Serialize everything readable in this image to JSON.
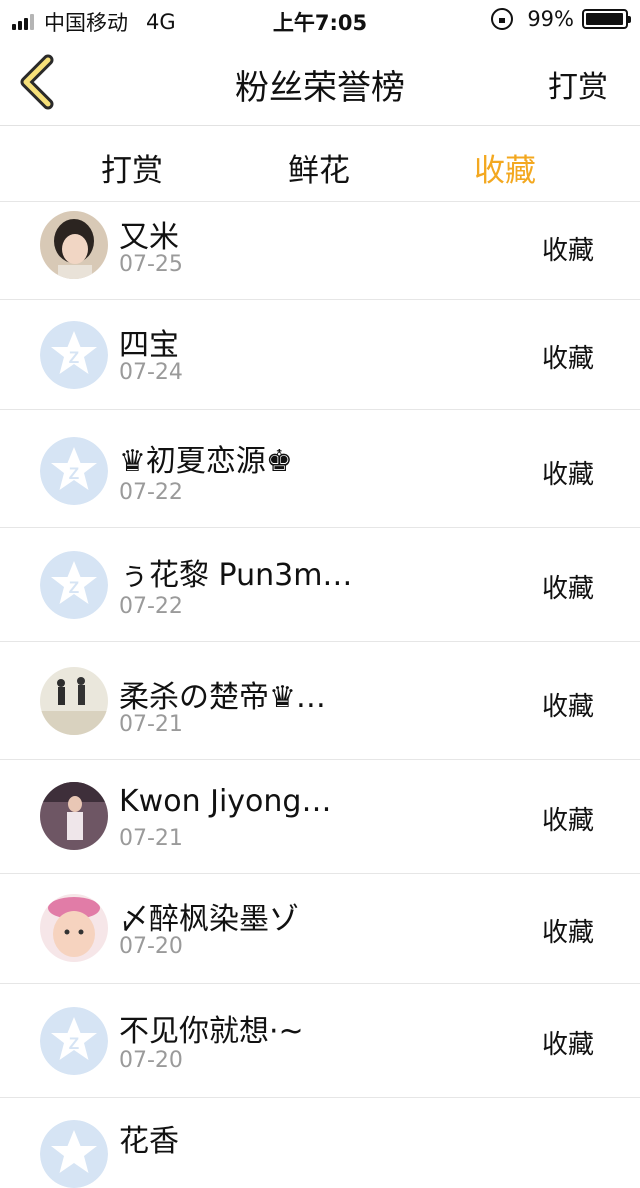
{
  "status_bar": {
    "carrier": "中国移动",
    "network": "4G",
    "time": "上午7:05",
    "battery": "99%"
  },
  "nav": {
    "title": "粉丝荣誉榜",
    "action": "打赏"
  },
  "tabs": [
    {
      "label": "打赏",
      "active": false
    },
    {
      "label": "鲜花",
      "active": false
    },
    {
      "label": "收藏",
      "active": true
    }
  ],
  "colors": {
    "accent": "#f3a820",
    "date_text": "#9a9a9a",
    "placeholder_avatar": "#d6e4f4"
  },
  "fans": [
    {
      "name": "又米",
      "date": "07-25",
      "action": "收藏",
      "avatar": "photo-girl"
    },
    {
      "name": "四宝",
      "date": "07-24",
      "action": "收藏",
      "avatar": "default-star"
    },
    {
      "name": "♛初夏恋源♚",
      "date": "07-22",
      "action": "收藏",
      "avatar": "default-star"
    },
    {
      "name": "ぅ花黎 Pun3m…",
      "date": "07-22",
      "action": "收藏",
      "avatar": "default-star"
    },
    {
      "name": "柔杀の楚帝♛…",
      "date": "07-21",
      "action": "收藏",
      "avatar": "photo-beach"
    },
    {
      "name": "Kwon Jiyong…",
      "date": "07-21",
      "action": "收藏",
      "avatar": "photo-woman"
    },
    {
      "name": "〆醉枫染墨ゾ",
      "date": "07-20",
      "action": "收藏",
      "avatar": "photo-child"
    },
    {
      "name": "不见你就想·~",
      "date": "07-20",
      "action": "收藏",
      "avatar": "default-star"
    },
    {
      "name": "花香",
      "date": "",
      "action": "",
      "avatar": "default-star"
    }
  ]
}
